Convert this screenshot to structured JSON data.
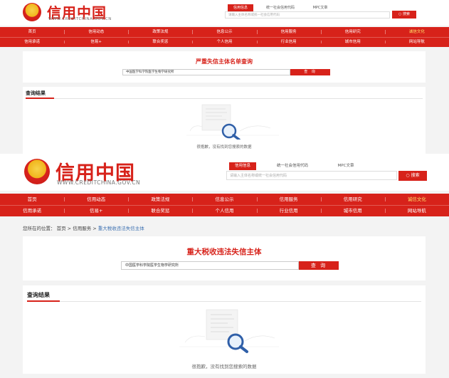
{
  "brand": {
    "logo_text": "信用中国",
    "url_text": "WWW.CREDITCHINA.GOV.CN",
    "accent": "#d7221a"
  },
  "shot1": {
    "search_tabs": [
      "信用信息",
      "统一社会信用代码",
      "MPC文章"
    ],
    "search_placeholder": "请输入主体名称或统一社会信用代码",
    "search_button": "搜索",
    "nav_row1": [
      "首页",
      "信用动态",
      "政策法规",
      "信息公示",
      "信用服务",
      "信用研究",
      "诚信文化"
    ],
    "nav_row2": [
      "信用承诺",
      "信易+",
      "联合奖惩",
      "个人信用",
      "行业信用",
      "城市信用",
      "网站导航"
    ],
    "query_title": "严重失信主体名单查询",
    "query_value": "中国医学科学院医学生物学研究所",
    "query_button": "查 询",
    "results_title": "查询结果",
    "empty_message": "很抱歉，没有找到您搜索的数据"
  },
  "shot2": {
    "search_tabs": [
      "信用信息",
      "统一社会信用代码",
      "MPC文章"
    ],
    "search_placeholder": "请输入主体名称或统一社会信用代码",
    "search_button": "搜索",
    "nav_row1": [
      "首页",
      "信用动态",
      "政策法规",
      "信息公示",
      "信用服务",
      "信用研究",
      "诚信文化"
    ],
    "nav_row2": [
      "信用承诺",
      "信易+",
      "联合奖惩",
      "个人信用",
      "行业信用",
      "城市信用",
      "网站导航"
    ],
    "breadcrumb_prefix": "您所在的位置：",
    "breadcrumb": [
      "首页",
      "信用服务",
      "重大税收违法失信主体"
    ],
    "breadcrumb_sep": ">",
    "query_title": "重大税收违法失信主体",
    "query_value": "中国医学科学院医学生物学研究所",
    "query_button": "查 询",
    "results_title": "查询结果",
    "empty_message": "很抱歉，没有找到您搜索的数据"
  }
}
